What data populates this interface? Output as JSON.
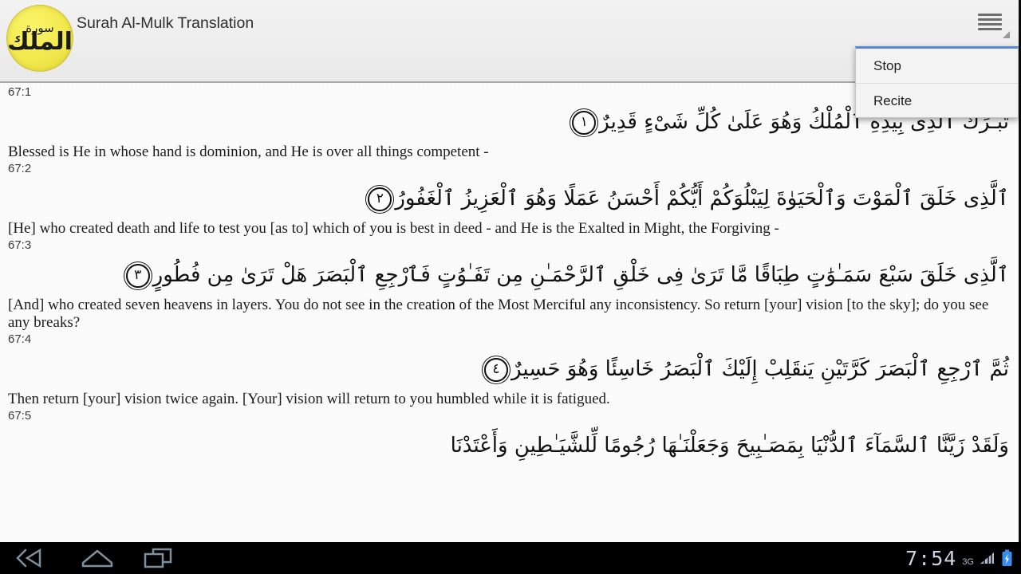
{
  "app": {
    "title": "Surah Al-Mulk Translation",
    "icon_name": "surah-al-mulk-logo",
    "icon_text_top": "سورة",
    "icon_text_main": "الملك",
    "accent_color": "#f2e94e"
  },
  "toolbar": {
    "overflow_icon": "hamburger-menu-icon",
    "overflow_label": "More options"
  },
  "overflow_menu": {
    "visible": true,
    "accent_color": "#5a86d8",
    "items": [
      {
        "label": "Stop"
      },
      {
        "label": "Recite"
      }
    ]
  },
  "content": {
    "verses": [
      {
        "ref": "67:1",
        "arabic": "تَبَـٰرَكَ ٱلَّذِى بِيَدِهِ ٱلْمُلْكُ وَهُوَ عَلَىٰ كُلِّ شَىْءٍ قَدِيرٌ",
        "ayah_number": "١",
        "translation": "Blessed is He in whose hand is dominion, and He is over all things competent -"
      },
      {
        "ref": "67:2",
        "arabic": "ٱلَّذِى خَلَقَ ٱلْمَوْتَ وَٱلْحَيَوٰةَ لِيَبْلُوَكُمْ أَيُّكُمْ أَحْسَنُ عَمَلًا وَهُوَ ٱلْعَزِيزُ ٱلْغَفُورُ",
        "ayah_number": "٢",
        "translation": "[He] who created death and life to test you [as to] which of you is best in deed - and He is the Exalted in Might, the Forgiving -"
      },
      {
        "ref": "67:3",
        "arabic": "ٱلَّذِى خَلَقَ سَبْعَ سَمَـٰوَٰتٍ طِبَاقًا مَّا تَرَىٰ فِى خَلْقِ ٱلرَّحْمَـٰنِ مِن تَفَـٰوُتٍ فَٱرْجِعِ ٱلْبَصَرَ هَلْ تَرَىٰ مِن فُطُورٍ",
        "ayah_number": "٣",
        "translation": "[And] who created seven heavens in layers. You do not see in the creation of the Most Merciful any inconsistency. So return [your] vision [to the sky]; do you see any breaks?"
      },
      {
        "ref": "67:4",
        "arabic": "ثُمَّ ٱرْجِعِ ٱلْبَصَرَ كَرَّتَيْنِ يَنقَلِبْ إِلَيْكَ ٱلْبَصَرُ خَاسِئًا وَهُوَ حَسِيرٌ",
        "ayah_number": "٤",
        "translation": "Then return [your] vision twice again. [Your] vision will return to you humbled while it is fatigued."
      },
      {
        "ref": "67:5",
        "arabic": "وَلَقَدْ زَيَّنَّا ٱلسَّمَآءَ ٱلدُّنْيَا بِمَصَـٰبِيحَ وَجَعَلْنَـٰهَا رُجُومًا لِّلشَّيَـٰطِينِ وَأَعْتَدْنَا",
        "ayah_number": "",
        "translation": ""
      }
    ]
  },
  "system_bar": {
    "back_icon": "back-arrow-icon",
    "home_icon": "home-icon",
    "recent_icon": "recent-apps-icon",
    "clock": "7:54",
    "network": "3G",
    "signal_icon": "signal-bars-icon",
    "battery_icon": "battery-charging-icon",
    "battery_color": "#3b8ef0"
  }
}
